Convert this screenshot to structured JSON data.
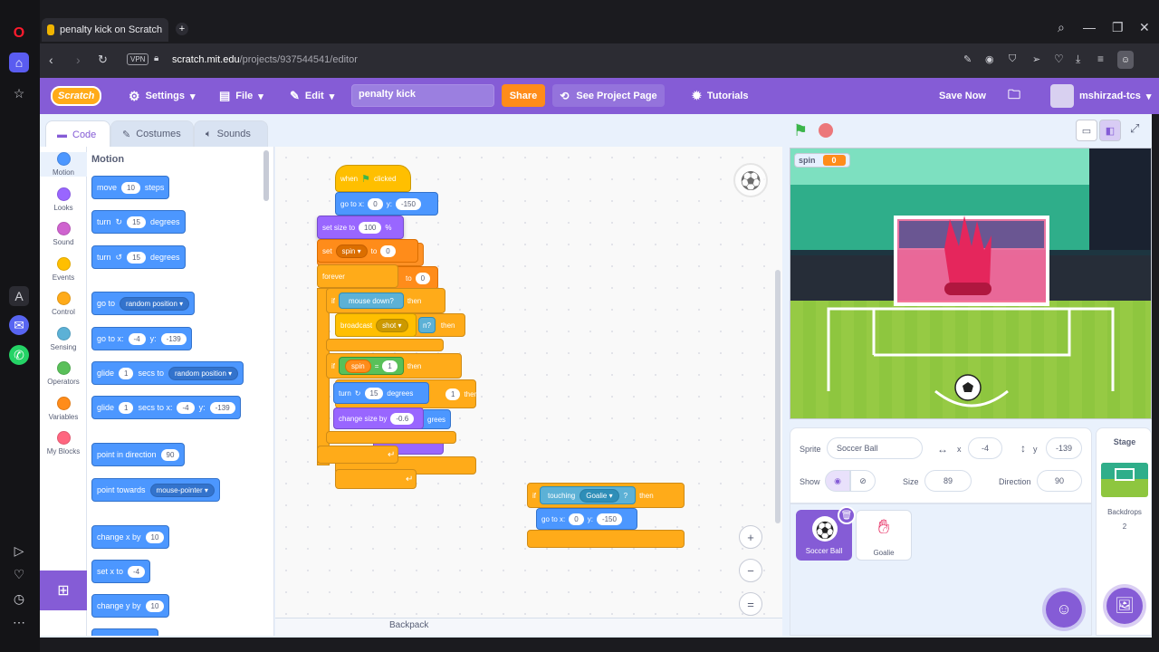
{
  "browser": {
    "tab_title": "penalty kick on Scratch",
    "url_host": "scratch.mit.edu",
    "url_path": "/projects/937544541/editor",
    "vpn_label": "VPN"
  },
  "menubar": {
    "logo": "Scratch",
    "settings": "Settings",
    "file": "File",
    "edit": "Edit",
    "project_title": "penalty kick",
    "share": "Share",
    "see_project_page": "See Project Page",
    "tutorials": "Tutorials",
    "save_now": "Save Now",
    "username": "mshirzad-tcs"
  },
  "editor_tabs": {
    "code": "Code",
    "costumes": "Costumes",
    "sounds": "Sounds"
  },
  "categories": [
    {
      "label": "Motion",
      "color": "#4c97ff"
    },
    {
      "label": "Looks",
      "color": "#9966ff"
    },
    {
      "label": "Sound",
      "color": "#cf63cf"
    },
    {
      "label": "Events",
      "color": "#ffbf00"
    },
    {
      "label": "Control",
      "color": "#ffab19"
    },
    {
      "label": "Sensing",
      "color": "#5cb1d6"
    },
    {
      "label": "Operators",
      "color": "#59c059"
    },
    {
      "label": "Variables",
      "color": "#ff8c1a"
    },
    {
      "label": "My Blocks",
      "color": "#ff6680"
    }
  ],
  "palette": {
    "heading": "Motion",
    "move": {
      "a": "move",
      "v": "10",
      "b": "steps"
    },
    "turn_right": {
      "a": "turn",
      "v": "15",
      "b": "degrees"
    },
    "turn_left": {
      "a": "turn",
      "v": "15",
      "b": "degrees"
    },
    "goto": {
      "a": "go to",
      "dd": "random position"
    },
    "gotoxy": {
      "a": "go to x:",
      "x": "-4",
      "y_label": "y:",
      "y": "-139"
    },
    "glide_to": {
      "a": "glide",
      "v": "1",
      "b": "secs to",
      "dd": "random position"
    },
    "glide_xy": {
      "a": "glide",
      "v": "1",
      "b": "secs to x:",
      "x": "-4",
      "y_label": "y:",
      "y": "-139"
    },
    "point_dir": {
      "a": "point in direction",
      "v": "90"
    },
    "point_towards": {
      "a": "point towards",
      "dd": "mouse-pointer"
    },
    "change_x": {
      "a": "change x by",
      "v": "10"
    },
    "set_x": {
      "a": "set x to",
      "v": "-4"
    },
    "change_y": {
      "a": "change y by",
      "v": "10"
    }
  },
  "workspace": {
    "hat": {
      "a": "when",
      "b": "clicked"
    },
    "goto1": {
      "a": "go to x:",
      "x": "0",
      "y_label": "y:",
      "y": "-150"
    },
    "set_size": {
      "a": "set size to",
      "v": "100",
      "b": "%"
    },
    "set_var": {
      "a": "set",
      "dd": "spin",
      "b": "to",
      "v": "0"
    },
    "hidden_to": {
      "a": "to",
      "v": "0"
    },
    "forever": "forever",
    "if1": {
      "a": "if",
      "cond": "mouse down?",
      "b": "then"
    },
    "hidden_then": {
      "a": "n?",
      "b": "then"
    },
    "broadcast": {
      "a": "broadcast",
      "dd": "shot"
    },
    "if2": {
      "a": "if",
      "var": "spin",
      "op": "=",
      "v": "1",
      "b": "then"
    },
    "turn": {
      "a": "turn",
      "v": "15",
      "b": "degrees"
    },
    "hidden_1": {
      "v": "1",
      "b": "then"
    },
    "change_size": {
      "a": "change size by",
      "v": "-0.6"
    },
    "hidden_grees": "grees",
    "if3": {
      "a": "if",
      "cond": "touching",
      "dd": "Goalie",
      "q": "?",
      "b": "then"
    },
    "goto2": {
      "a": "go to x:",
      "x": "0",
      "y_label": "y:",
      "y": "-150"
    },
    "backpack": "Backpack",
    "zoom_in": "+",
    "zoom_out": "−",
    "zoom_reset": "="
  },
  "stage": {
    "monitor_name": "spin",
    "monitor_value": "0"
  },
  "sprite_info": {
    "sprite_label": "Sprite",
    "sprite_name": "Soccer Ball",
    "x_label": "x",
    "x": "-4",
    "y_label": "y",
    "y": "-139",
    "show_label": "Show",
    "size_label": "Size",
    "size": "89",
    "direction_label": "Direction",
    "direction": "90"
  },
  "sprites": [
    {
      "name": "Soccer Ball",
      "selected": true
    },
    {
      "name": "Goalie",
      "selected": false
    }
  ],
  "stage_panel": {
    "title": "Stage",
    "backdrops_label": "Backdrops",
    "backdrops_count": "2"
  }
}
